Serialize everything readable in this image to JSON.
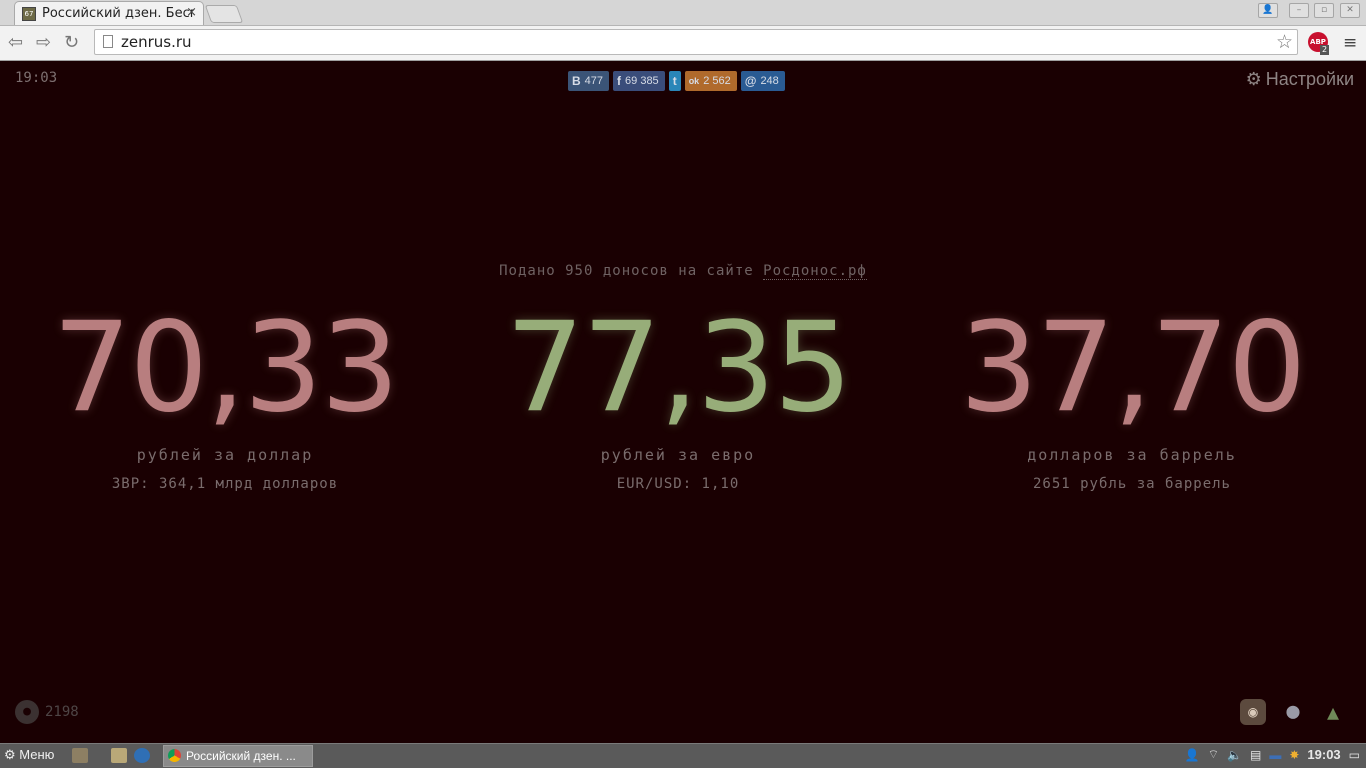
{
  "browser": {
    "tab_title": "Российский дзен. Бесплатно",
    "tab_favicon": "67",
    "tab_close": "×",
    "url": "zenrus.ru"
  },
  "page": {
    "clock": "19:03",
    "shares": [
      {
        "network": "vk",
        "icon": "B",
        "count": "477",
        "color": "#3b5477"
      },
      {
        "network": "facebook",
        "icon": "f",
        "count": "69 385",
        "color": "#3a4d7a"
      },
      {
        "network": "twitter",
        "icon": "t",
        "count": "",
        "color": "#2a86b8"
      },
      {
        "network": "odnoklassniki",
        "icon": "ok",
        "count": "2 562",
        "color": "#b06a2c"
      },
      {
        "network": "mail",
        "icon": "@",
        "count": "248",
        "color": "#2a5b93"
      }
    ],
    "settings_label": "Настройки",
    "donos_text": "Подано 950 доносов на сайте ",
    "donos_link": "Росдонос.рф",
    "rates": [
      {
        "value": "70,33",
        "color": "#b87e7f",
        "label": "рублей за доллар",
        "sub": "ЗВР: 364,1 млрд долларов"
      },
      {
        "value": "77,35",
        "color": "#97ad79",
        "label": "рублей за евро",
        "sub": "EUR/USD: 1,10"
      },
      {
        "value": "37,70",
        "color": "#b87e7f",
        "label": "долларов за баррель",
        "sub": "2651 рубль за баррель"
      }
    ],
    "visitors": "2198"
  },
  "taskbar": {
    "menu_label": "Меню",
    "window_title": "Российский дзен. ...",
    "time": "19:03"
  }
}
